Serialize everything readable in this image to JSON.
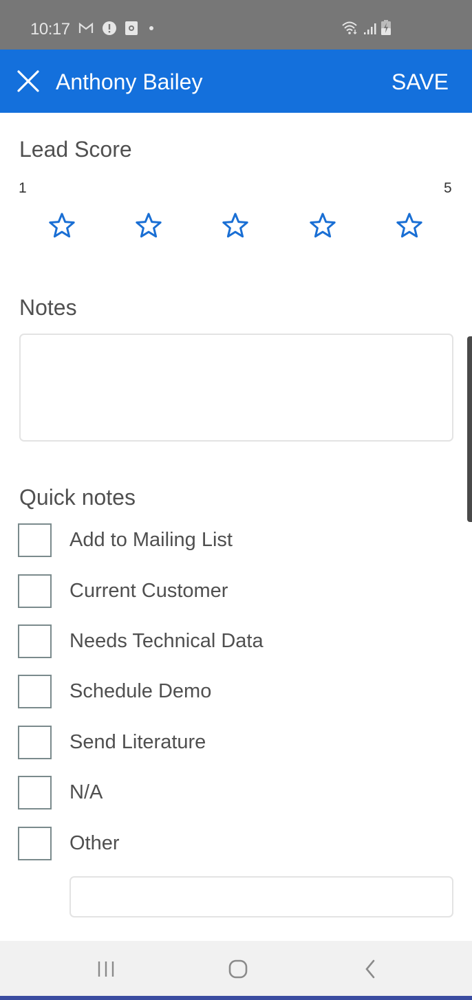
{
  "status_bar": {
    "time": "10:17",
    "left_icons": [
      "gmail-icon",
      "alert-icon",
      "screen-record-icon",
      "dot-icon"
    ],
    "right_icons": [
      "wifi-icon",
      "signal-icon",
      "battery-charging-icon"
    ]
  },
  "app_bar": {
    "close_icon": "close-icon",
    "title": "Anthony Bailey",
    "save_label": "SAVE",
    "background_color": "#1470dc"
  },
  "lead_score": {
    "label": "Lead Score",
    "min_label": "1",
    "max_label": "5",
    "max_stars": 5,
    "value": 0,
    "star_color": "#1a6fd4"
  },
  "notes": {
    "label": "Notes",
    "value": "",
    "placeholder": ""
  },
  "quick_notes": {
    "label": "Quick notes",
    "options": [
      {
        "label": "Add to Mailing List",
        "checked": false
      },
      {
        "label": "Current Customer",
        "checked": false
      },
      {
        "label": "Needs Technical Data",
        "checked": false
      },
      {
        "label": "Schedule Demo",
        "checked": false
      },
      {
        "label": "Send Literature",
        "checked": false
      },
      {
        "label": "N/A",
        "checked": false
      },
      {
        "label": "Other",
        "checked": false
      }
    ],
    "other_value": "",
    "other_placeholder": ""
  },
  "nav_bar": {
    "buttons": [
      "recent-apps",
      "home",
      "back"
    ]
  }
}
